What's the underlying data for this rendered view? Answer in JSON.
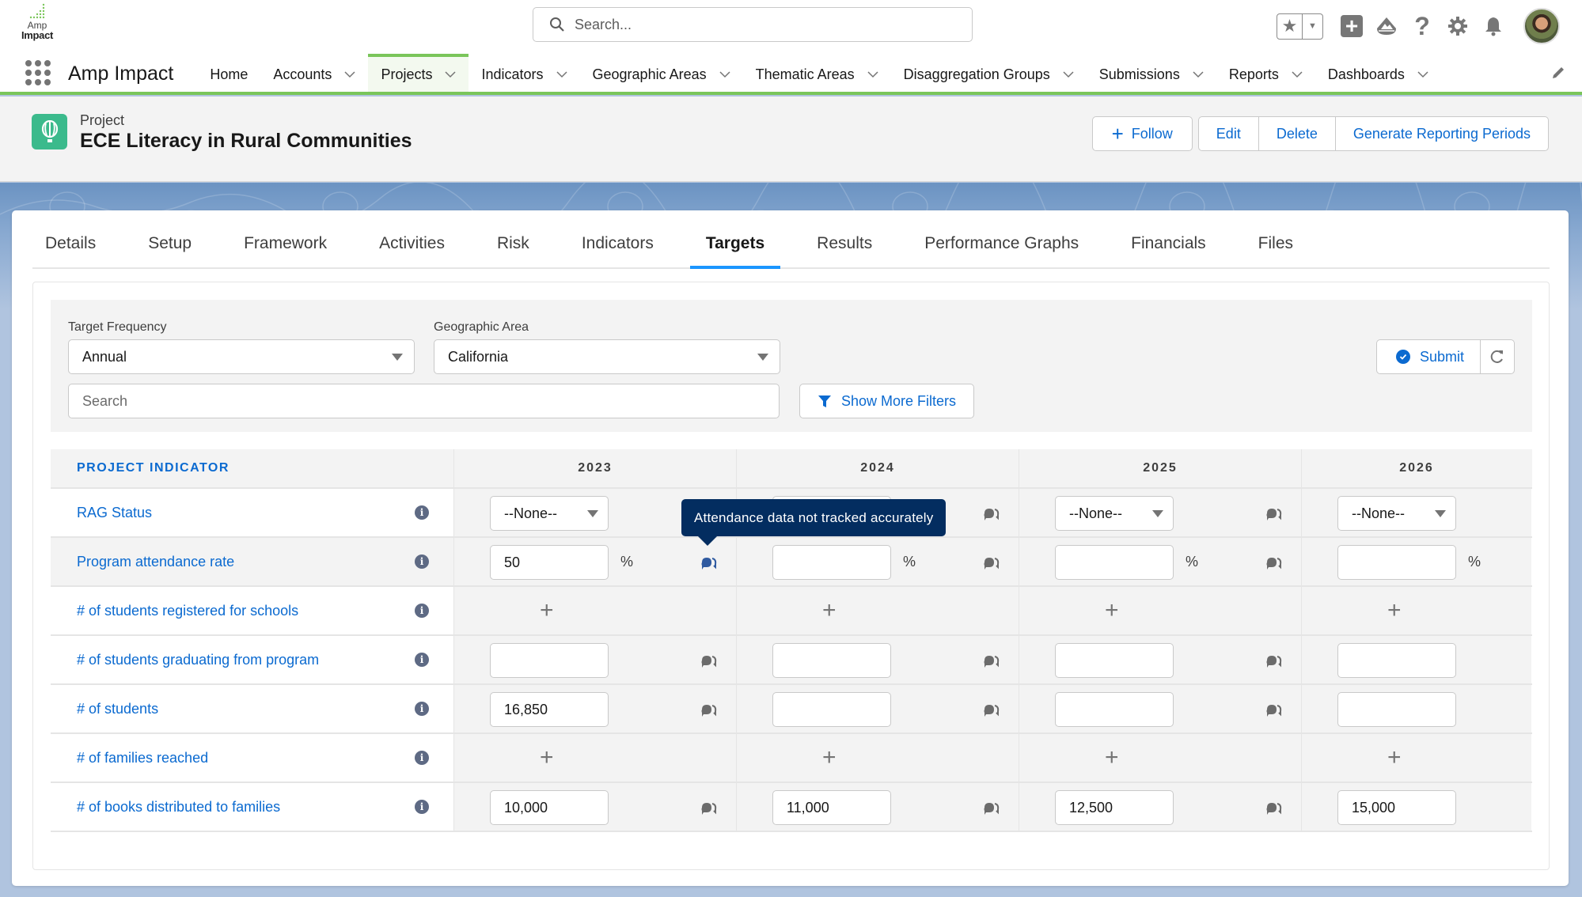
{
  "header": {
    "logo_line1": "Amp",
    "logo_line2": "Impact",
    "search_placeholder": "Search...",
    "icons": [
      "favorites-star-icon",
      "favorites-dropdown-icon",
      "global-create-icon",
      "trailhead-icon",
      "help-icon",
      "setup-gear-icon",
      "notifications-bell-icon",
      "user-avatar"
    ]
  },
  "nav": {
    "app_name": "Amp Impact",
    "items": [
      {
        "label": "Home",
        "has_menu": false,
        "active": false
      },
      {
        "label": "Accounts",
        "has_menu": true,
        "active": false
      },
      {
        "label": "Projects",
        "has_menu": true,
        "active": true
      },
      {
        "label": "Indicators",
        "has_menu": true,
        "active": false
      },
      {
        "label": "Geographic Areas",
        "has_menu": true,
        "active": false
      },
      {
        "label": "Thematic Areas",
        "has_menu": true,
        "active": false
      },
      {
        "label": "Disaggregation Groups",
        "has_menu": true,
        "active": false
      },
      {
        "label": "Submissions",
        "has_menu": true,
        "active": false
      },
      {
        "label": "Reports",
        "has_menu": true,
        "active": false
      },
      {
        "label": "Dashboards",
        "has_menu": true,
        "active": false
      }
    ],
    "accent_color": "#7ac55a"
  },
  "record": {
    "object_type": "Project",
    "title": "ECE Literacy in Rural Communities",
    "icon_color": "#3bba8c",
    "actions": {
      "follow": "Follow",
      "edit": "Edit",
      "delete": "Delete",
      "generate": "Generate Reporting Periods"
    }
  },
  "tabs": {
    "items": [
      "Details",
      "Setup",
      "Framework",
      "Activities",
      "Risk",
      "Indicators",
      "Targets",
      "Results",
      "Performance Graphs",
      "Financials",
      "Files"
    ],
    "active": "Targets"
  },
  "filters": {
    "target_frequency_label": "Target Frequency",
    "target_frequency_value": "Annual",
    "geographic_area_label": "Geographic Area",
    "geographic_area_value": "California",
    "search_placeholder": "Search",
    "show_more_filters": "Show More Filters",
    "submit": "Submit"
  },
  "table": {
    "indicator_header": "PROJECT INDICATOR",
    "years": [
      "2023",
      "2024",
      "2025",
      "2026"
    ],
    "rows": [
      {
        "indicator": "RAG Status",
        "type": "select",
        "unit": "",
        "values": [
          "--None--",
          "",
          "--None--",
          "--None--"
        ]
      },
      {
        "indicator": "Program attendance rate",
        "type": "input",
        "unit": "%",
        "values": [
          "50",
          "",
          "",
          ""
        ]
      },
      {
        "indicator": "# of students registered for schools",
        "type": "add",
        "unit": "",
        "values": []
      },
      {
        "indicator": "# of students graduating from program",
        "type": "input",
        "unit": "",
        "values": [
          "",
          "",
          "",
          ""
        ]
      },
      {
        "indicator": "# of students",
        "type": "input",
        "unit": "",
        "values": [
          "16,850",
          "",
          "",
          ""
        ]
      },
      {
        "indicator": "# of families reached",
        "type": "add",
        "unit": "",
        "values": []
      },
      {
        "indicator": "# of books distributed to families",
        "type": "input",
        "unit": "",
        "values": [
          "10,000",
          "11,000",
          "12,500",
          "15,000"
        ]
      }
    ]
  },
  "tooltip": {
    "text": "Attendance data not tracked accurately"
  }
}
